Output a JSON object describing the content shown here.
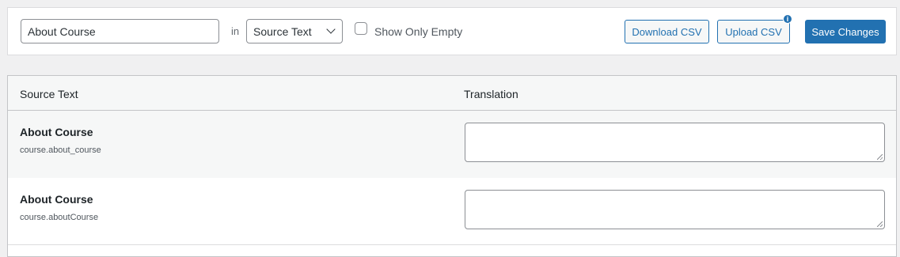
{
  "toolbar": {
    "search_value": "About Course",
    "in_label": "in",
    "select_value": "Source Text",
    "checkbox_label": "Show Only Empty",
    "download_label": "Download CSV",
    "upload_label": "Upload CSV",
    "info_badge": "i",
    "save_label": "Save Changes"
  },
  "table": {
    "headers": [
      "Source Text",
      "Translation"
    ],
    "rows": [
      {
        "title": "About Course",
        "key": "course.about_course",
        "translation": ""
      },
      {
        "title": "About Course",
        "key": "course.aboutCourse",
        "translation": ""
      }
    ]
  },
  "colors": {
    "accent": "#2271b1",
    "page_bg": "#f0f0f1"
  }
}
